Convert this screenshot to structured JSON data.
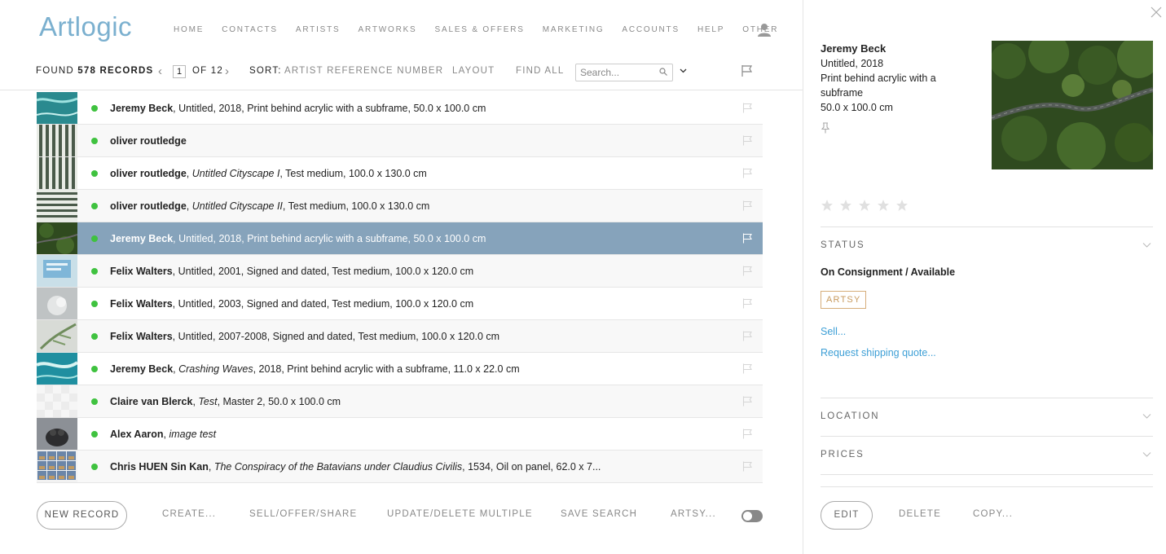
{
  "app": {
    "logo": "Artlogic"
  },
  "nav": {
    "items": [
      "HOME",
      "CONTACTS",
      "ARTISTS",
      "ARTWORKS",
      "SALES & OFFERS",
      "MARKETING",
      "ACCOUNTS",
      "HELP",
      "OTHER"
    ]
  },
  "toolbar": {
    "found_prefix": "FOUND",
    "found_count": "578 RECORDS",
    "page_current": "1",
    "page_total": "OF 12",
    "sort_label": "SORT:",
    "sort_value": "ARTIST REFERENCE NUMBER",
    "layout_label": "LAYOUT",
    "find_all_label": "FIND ALL",
    "search_placeholder": "Search..."
  },
  "records": [
    {
      "artist": "Jeremy Beck",
      "title": "Untitled",
      "title_italic": false,
      "rest": ", 2018, Print behind acrylic with a subframe, 50.0 x 100.0 cm",
      "thumb": "aerial-sea",
      "selected": false
    },
    {
      "artist": "oliver routledge",
      "title": "",
      "title_italic": false,
      "rest": "",
      "thumb": "stripes",
      "selected": false
    },
    {
      "artist": "oliver routledge",
      "title": "Untitled Cityscape I",
      "title_italic": true,
      "rest": ", Test medium, 100.0 x 130.0 cm",
      "thumb": "stripes",
      "selected": false
    },
    {
      "artist": "oliver routledge",
      "title": "Untitled Cityscape II",
      "title_italic": true,
      "rest": ", Test medium, 100.0 x 130.0 cm",
      "thumb": "stripes-h",
      "selected": false
    },
    {
      "artist": "Jeremy Beck",
      "title": "Untitled",
      "title_italic": false,
      "rest": ", 2018, Print behind acrylic with a subframe, 50.0 x 100.0 cm",
      "thumb": "forest",
      "selected": true
    },
    {
      "artist": "Felix Walters",
      "title": "Untitled",
      "title_italic": false,
      "rest": ", 2001, Signed and dated, Test medium, 100.0 x 120.0 cm",
      "thumb": "screen",
      "selected": false
    },
    {
      "artist": "Felix Walters",
      "title": "Untitled",
      "title_italic": false,
      "rest": ", 2003, Signed and dated, Test medium, 100.0 x 120.0 cm",
      "thumb": "grey",
      "selected": false
    },
    {
      "artist": "Felix Walters",
      "title": "Untitled",
      "title_italic": false,
      "rest": ", 2007-2008, Signed and dated, Test medium, 100.0 x 120.0 cm",
      "thumb": "palm",
      "selected": false
    },
    {
      "artist": "Jeremy Beck",
      "title": "Crashing Waves",
      "title_italic": true,
      "rest": ", 2018, Print behind acrylic with a subframe, 11.0 x 22.0 cm",
      "thumb": "waves",
      "selected": false
    },
    {
      "artist": "Claire van Blerck",
      "title": "Test",
      "title_italic": true,
      "rest": ", Master 2, 50.0 x 100.0 cm",
      "thumb": "checker",
      "selected": false
    },
    {
      "artist": "Alex Aaron",
      "title": "image test",
      "title_italic": true,
      "rest": "",
      "thumb": "dog",
      "selected": false
    },
    {
      "artist": "Chris HUEN Sin Kan",
      "title": "The Conspiracy of the Batavians under Claudius Civilis",
      "title_italic": true,
      "rest": ", 1534, Oil on panel, 62.0 x 7...",
      "thumb": "grid",
      "selected": false
    }
  ],
  "bottom_bar": {
    "new_record": "NEW RECORD",
    "create": "CREATE...",
    "sell_offer_share": "SELL/OFFER/SHARE",
    "update_delete_multiple": "UPDATE/DELETE MULTIPLE",
    "save_search": "SAVE SEARCH",
    "artsy": "ARTSY..."
  },
  "detail": {
    "artist": "Jeremy Beck",
    "title_line": "Untitled, 2018",
    "medium": "Print behind acrylic with a subframe",
    "dimensions": "50.0 x 100.0 cm",
    "rating": 0,
    "status_title": "STATUS",
    "status_value": "On Consignment / Available",
    "artsy_badge": "ARTSY",
    "sell_link": "Sell...",
    "shipping_link": "Request shipping quote...",
    "location_title": "LOCATION",
    "prices_title": "PRICES",
    "edit": "EDIT",
    "delete": "DELETE",
    "copy": "COPY..."
  },
  "colors": {
    "brand": "#7bb0cf",
    "selected_row": "#86a3bb",
    "status_dot": "#3fc23f",
    "link": "#3d9fd6",
    "artsy_badge": "#c79a5e"
  }
}
